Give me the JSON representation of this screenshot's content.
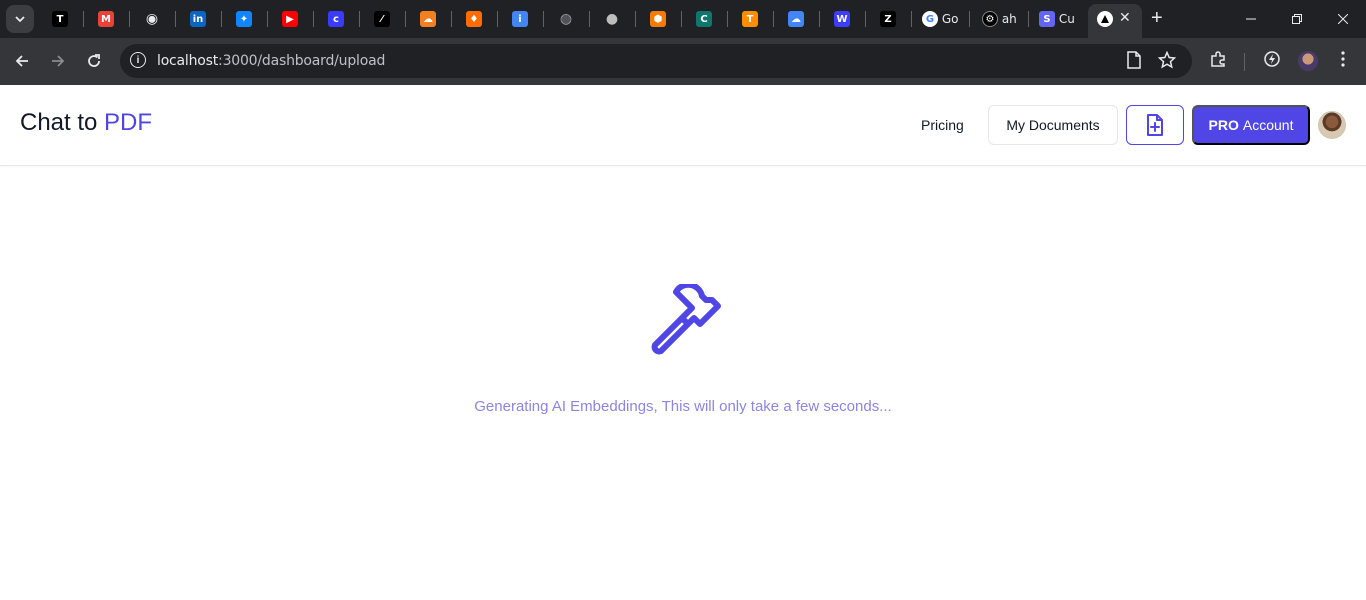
{
  "browser": {
    "tabs": [
      {
        "icon": "t-square-icon",
        "color": "#000000"
      },
      {
        "icon": "gmail-icon",
        "color": "#ea4335"
      },
      {
        "icon": "chat-bubble-icon",
        "color": "#e8eaed"
      },
      {
        "icon": "linkedin-icon",
        "color": "#0a66c2"
      },
      {
        "icon": "butterfly-icon",
        "color": "#1185fe"
      },
      {
        "icon": "youtube-icon",
        "color": "#ff0000"
      },
      {
        "icon": "c-circle-icon",
        "color": "#3b3bff"
      },
      {
        "icon": "slash-square-icon",
        "color": "#000000"
      },
      {
        "icon": "cloudflare-icon",
        "color": "#f38020"
      },
      {
        "icon": "flame-icon",
        "color": "#ff6d00"
      },
      {
        "icon": "info-square-icon",
        "color": "#4285f4"
      },
      {
        "icon": "globe-icon",
        "color": "#9aa0a6"
      },
      {
        "icon": "cookie-icon",
        "color": "#bdbdbd"
      },
      {
        "icon": "hexagon-icon",
        "color": "#f57c00"
      },
      {
        "icon": "c-square-icon",
        "color": "#0f766e"
      },
      {
        "icon": "tensorflow-icon",
        "color": "#ff8f00"
      },
      {
        "icon": "google-cloud-icon",
        "color": "#4285f4"
      },
      {
        "icon": "w-logo-icon",
        "color": "#3d3dff"
      },
      {
        "icon": "z-square-icon",
        "color": "#000000"
      }
    ],
    "labeled_tabs": [
      {
        "icon": "google-icon",
        "text": "Go"
      },
      {
        "icon": "openai-icon",
        "text": "ah"
      },
      {
        "icon": "s-square-icon",
        "text": "Cu"
      }
    ],
    "active_tab": {
      "icon": "triangle-icon",
      "close": "✕"
    },
    "new_tab": "+",
    "url_host": "localhost",
    "url_path": ":3000/dashboard/upload"
  },
  "header": {
    "logo_prefix": "Chat to ",
    "logo_accent": "PDF",
    "pricing_label": "Pricing",
    "documents_label": "My Documents",
    "pro_bold": "PRO",
    "pro_label": "Account"
  },
  "main": {
    "status_text": "Generating AI Embeddings, This will only take a few seconds..."
  },
  "colors": {
    "accent": "#4f46e5",
    "status_text": "#8b86df"
  }
}
